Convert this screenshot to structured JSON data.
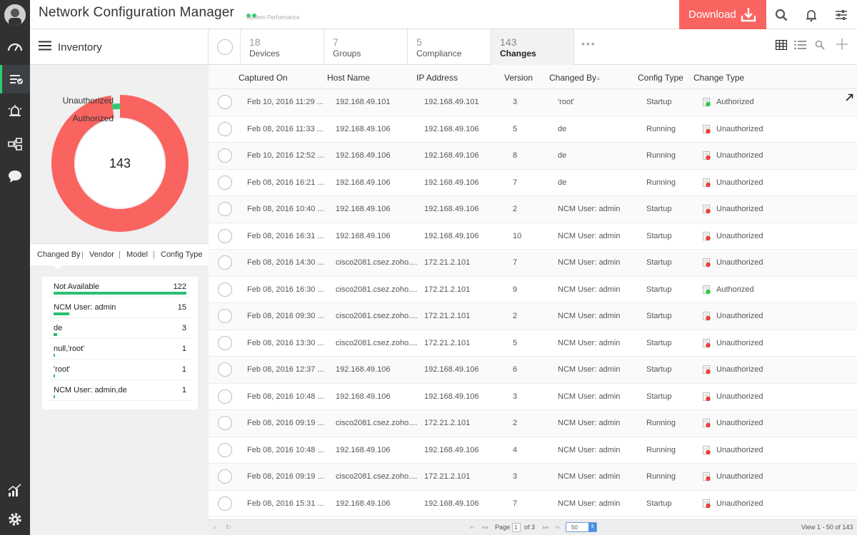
{
  "header": {
    "app_title": "Network Configuration Manager",
    "subtitle": "System Performance",
    "download_label": "Download"
  },
  "colors": {
    "accent_green": "#2ecc71",
    "download_red": "#f96461",
    "donut_red": "#f96461",
    "bar_green": "#2bbf73"
  },
  "sidebar": {
    "items": [
      "dashboard-icon",
      "inventory-icon",
      "alarms-icon",
      "network-icon",
      "chat-icon",
      "reports-icon",
      "settings-icon"
    ]
  },
  "inventory": {
    "label": "Inventory"
  },
  "stats": [
    {
      "num": "18",
      "label": "Devices"
    },
    {
      "num": "7",
      "label": "Groups"
    },
    {
      "num": "5",
      "label": "Compliance"
    },
    {
      "num": "143",
      "label": "Changes"
    }
  ],
  "donut": {
    "total": "143",
    "legend": [
      {
        "label": "Unauthorized",
        "value": 140
      },
      {
        "label": "Authorized",
        "value": 3
      }
    ]
  },
  "group_tabs": [
    "Changed By",
    "Vendor",
    "Model",
    "Config Type"
  ],
  "changed_by_list": [
    {
      "name": "Not Available",
      "count": "122",
      "frac": 1.0
    },
    {
      "name": "NCM User: admin",
      "count": "15",
      "frac": 0.12
    },
    {
      "name": "de",
      "count": "3",
      "frac": 0.025
    },
    {
      "name": "null,'root'",
      "count": "1",
      "frac": 0.01
    },
    {
      "name": "'root'",
      "count": "1",
      "frac": 0.01
    },
    {
      "name": "NCM User: admin,de",
      "count": "1",
      "frac": 0.01
    }
  ],
  "table": {
    "headers": [
      "Captured On",
      "Host Name",
      "IP Address",
      "Version",
      "Changed By",
      "Config Type",
      "Change Type"
    ],
    "rows": [
      [
        "Feb 10, 2016 11:29 ...",
        "192.168.49.101",
        "192.168.49.101",
        "3",
        "'root'",
        "Startup",
        "Authorized"
      ],
      [
        "Feb 08, 2016 11:33 ...",
        "192.168.49.106",
        "192.168.49.106",
        "5",
        "de",
        "Running",
        "Unauthorized"
      ],
      [
        "Feb 10, 2016 12:52 ...",
        "192.168.49.106",
        "192.168.49.106",
        "8",
        "de",
        "Running",
        "Unauthorized"
      ],
      [
        "Feb 08, 2016 16:21 ...",
        "192.168.49.106",
        "192.168.49.106",
        "7",
        "de",
        "Running",
        "Unauthorized"
      ],
      [
        "Feb 08, 2016 10:40 ...",
        "192.168.49.106",
        "192.168.49.106",
        "2",
        "NCM User: admin",
        "Startup",
        "Unauthorized"
      ],
      [
        "Feb 08, 2016 16:31 ...",
        "192.168.49.106",
        "192.168.49.106",
        "10",
        "NCM User: admin",
        "Startup",
        "Unauthorized"
      ],
      [
        "Feb 08, 2016 14:30 ...",
        "cisco2081.csez.zoho....",
        "172.21.2.101",
        "7",
        "NCM User: admin",
        "Startup",
        "Unauthorized"
      ],
      [
        "Feb 08, 2016 16:30 ...",
        "cisco2081.csez.zoho....",
        "172.21.2.101",
        "9",
        "NCM User: admin",
        "Startup",
        "Authorized"
      ],
      [
        "Feb 08, 2016 09:30 ...",
        "cisco2081.csez.zoho....",
        "172.21.2.101",
        "2",
        "NCM User: admin",
        "Startup",
        "Unauthorized"
      ],
      [
        "Feb 08, 2016 13:30 ...",
        "cisco2081.csez.zoho....",
        "172.21.2.101",
        "5",
        "NCM User: admin",
        "Startup",
        "Unauthorized"
      ],
      [
        "Feb 08, 2016 12:37 ...",
        "192.168.49.106",
        "192.168.49.106",
        "6",
        "NCM User: admin",
        "Startup",
        "Unauthorized"
      ],
      [
        "Feb 08, 2016 10:48 ...",
        "192.168.49.106",
        "192.168.49.106",
        "3",
        "NCM User: admin",
        "Startup",
        "Unauthorized"
      ],
      [
        "Feb 08, 2016 09:19 ...",
        "cisco2081.csez.zoho....",
        "172.21.2.101",
        "2",
        "NCM User: admin",
        "Running",
        "Unauthorized"
      ],
      [
        "Feb 08, 2016 10:48 ...",
        "192.168.49.106",
        "192.168.49.106",
        "4",
        "NCM User: admin",
        "Running",
        "Unauthorized"
      ],
      [
        "Feb 08, 2016 09:19 ...",
        "cisco2081.csez.zoho....",
        "172.21.2.101",
        "3",
        "NCM User: admin",
        "Running",
        "Unauthorized"
      ],
      [
        "Feb 08, 2016 15:31 ...",
        "192.168.49.106",
        "192.168.49.106",
        "7",
        "NCM User: admin",
        "Startup",
        "Unauthorized"
      ]
    ]
  },
  "pagination": {
    "page_label": "Page",
    "page": "1",
    "of_label": "of 3",
    "page_size": "50",
    "view_summary": "View 1 - 50 of 143"
  }
}
